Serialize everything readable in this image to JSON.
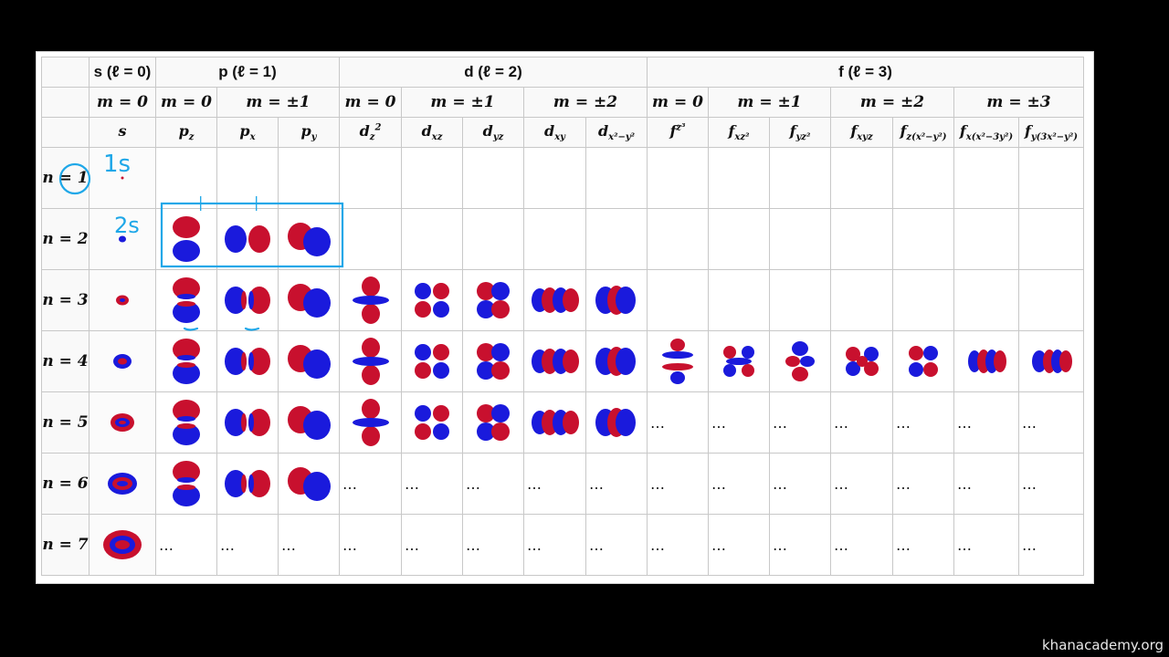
{
  "header": {
    "groups": [
      {
        "label": "s (ℓ = 0)"
      },
      {
        "label": "p (ℓ = 1)"
      },
      {
        "label": "d (ℓ = 2)"
      },
      {
        "label": "f (ℓ = 3)"
      }
    ],
    "m_values": [
      "m = 0",
      "m = 0",
      "m = ±1",
      "m = 0",
      "m = ±1",
      "m = ±2",
      "m = 0",
      "m = ±1",
      "m = ±2",
      "m = ±3"
    ],
    "orbitals": [
      {
        "base": "s",
        "sub": "",
        "sup": ""
      },
      {
        "base": "p",
        "sub": "z",
        "sup": ""
      },
      {
        "base": "p",
        "sub": "x",
        "sup": ""
      },
      {
        "base": "p",
        "sub": "y",
        "sup": ""
      },
      {
        "base": "d",
        "sub": "z",
        "sup": "2"
      },
      {
        "base": "d",
        "sub": "xz",
        "sup": ""
      },
      {
        "base": "d",
        "sub": "yz",
        "sup": ""
      },
      {
        "base": "d",
        "sub": "xy",
        "sup": ""
      },
      {
        "base": "d",
        "sub": "x²−y²",
        "sup": ""
      },
      {
        "base": "f",
        "sub": "",
        "sup": "z³"
      },
      {
        "base": "f",
        "sub": "xz²",
        "sup": ""
      },
      {
        "base": "f",
        "sub": "yz²",
        "sup": ""
      },
      {
        "base": "f",
        "sub": "xyz",
        "sup": ""
      },
      {
        "base": "f",
        "sub": "z(x²−y²)",
        "sup": ""
      },
      {
        "base": "f",
        "sub": "x(x²−3y²)",
        "sup": ""
      },
      {
        "base": "f",
        "sub": "y(3x²−y²)",
        "sup": ""
      }
    ]
  },
  "rows": [
    {
      "n": "n = 1",
      "cells": [
        "s1",
        "",
        "",
        "",
        "",
        "",
        "",
        "",
        "",
        "",
        "",
        "",
        "",
        "",
        "",
        ""
      ]
    },
    {
      "n": "n = 2",
      "cells": [
        "s2",
        "pz",
        "px",
        "py",
        "",
        "",
        "",
        "",
        "",
        "",
        "",
        "",
        "",
        "",
        "",
        ""
      ]
    },
    {
      "n": "n = 3",
      "cells": [
        "s3",
        "pz",
        "px",
        "py",
        "dz2",
        "dxz",
        "dyz",
        "dxy",
        "dx2",
        "",
        "",
        "",
        "",
        "",
        "",
        ""
      ]
    },
    {
      "n": "n = 4",
      "cells": [
        "s4",
        "pz",
        "px",
        "py",
        "dz2",
        "dxz",
        "dyz",
        "dxy",
        "dx2",
        "fz3",
        "fxz2",
        "fyz2",
        "fxyz",
        "fzx",
        "fx3",
        "fy3"
      ]
    },
    {
      "n": "n = 5",
      "cells": [
        "s5",
        "pz",
        "px",
        "py",
        "dz2",
        "dxz",
        "dyz",
        "dxy",
        "dx2",
        "…",
        "…",
        "…",
        "…",
        "…",
        "…",
        "…"
      ]
    },
    {
      "n": "n = 6",
      "cells": [
        "s6",
        "pz",
        "px",
        "py",
        "…",
        "…",
        "…",
        "…",
        "…",
        "…",
        "…",
        "…",
        "…",
        "…",
        "…",
        "…"
      ]
    },
    {
      "n": "n = 7",
      "cells": [
        "s7",
        "…",
        "…",
        "…",
        "…",
        "…",
        "…",
        "…",
        "…",
        "…",
        "…",
        "…",
        "…",
        "…",
        "…",
        "…"
      ]
    }
  ],
  "annotations": {
    "label_1s": "1s",
    "label_2s": "2s",
    "tick_1": "|",
    "tick_2": "|"
  },
  "colors": {
    "lobe_positive": "#c8102e",
    "lobe_negative": "#1a1adc",
    "annotation_ink": "#1ea7e8",
    "background": "#000000"
  },
  "watermark": "khanacademy.org"
}
